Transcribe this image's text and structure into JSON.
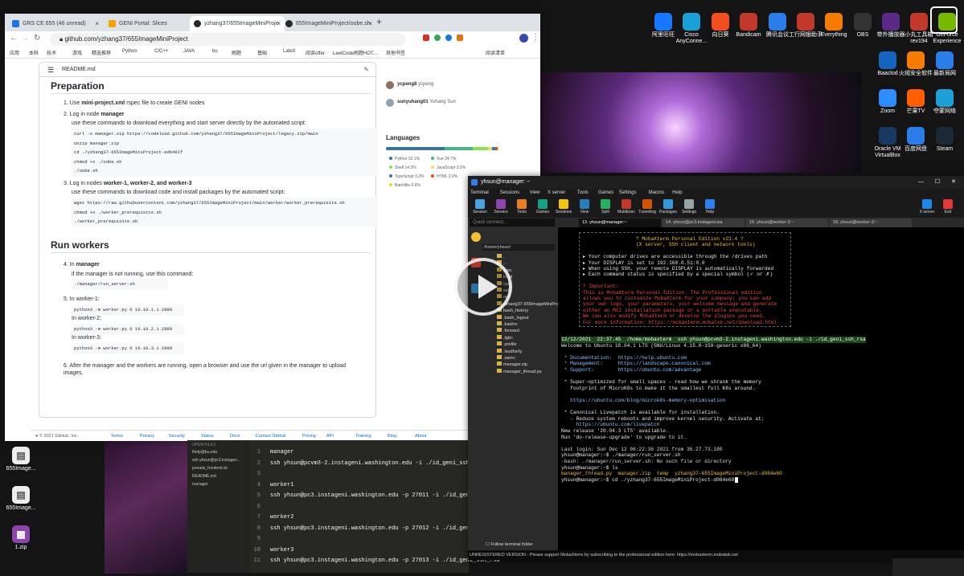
{
  "chrome": {
    "tabs": [
      {
        "title": "GRS CE 655 (46 unread)",
        "color": "#1a73e8"
      },
      {
        "title": "GENI Portal: Slices",
        "color": "#f4a300"
      },
      {
        "title": "yzhang37/655ImageMiniProje",
        "color": "#24292f"
      },
      {
        "title": "655ImageMiniProject/oobe.sh",
        "color": "#24292f"
      }
    ],
    "new_tab": "+",
    "url": "github.com/yzhang37/655ImageMiniProject",
    "bookmarks": [
      "应用",
      "本科",
      "技术",
      "游戏",
      "精选推荐",
      "Python",
      "C/C++",
      "JAVA",
      "bu",
      "刷题",
      "基础",
      "LateX",
      "阅读offer",
      "LeetCode刷题HOT...",
      "其他书签",
      "阅读清单"
    ]
  },
  "readme": {
    "file": "README.md",
    "preparation_heading": "Preparation",
    "step1_prefix": "1. Use ",
    "step1_bold": "mini-project.xml",
    "step1_rest": " rspec file to create GENI nodes",
    "step2_prefix": "2. Log in node ",
    "step2_bold": "manager",
    "step2_line2": "use these commands to download everything and start server directly by the automated script:",
    "code1": "curl -o manager.zip https://codeload.github.com/yzhang37/655ImageMiniProject/legacy.zip/main\nunzip manager.zip\ncd ./yzhang37-655ImageMiniProject-edb461f\nchmod +x ./oobe.sh\n./oobe.sh",
    "step3_prefix": "3. Log in nodes ",
    "step3_bold": "worker-1, worker-2, and worker-3",
    "step3_line2": "use these commands to download code and install packages by the automated script:",
    "code2": "wget https://raw.githubusercontent.com/yzhang37/655ImageMiniProject/main/worker/worker_prerequisite.sh\nchmod +x ./worker_prerequisite.sh\n./worker_prerequisite.sh",
    "run_heading": "Run workers",
    "step4_prefix": "4. In ",
    "step4_bold": "manager",
    "step4_line2": "if the manager is not running, use this command:",
    "code3": "./manager/run_server.sh",
    "step5": "5. In worker-1:",
    "code4": "python3 -m worker.py 0 10.10.1.1 2888",
    "w2": "In worker-2:",
    "code5": "python3 -m worker.py 0 10.10.2.1 2889",
    "w3": "In worker-3:",
    "code6": "python3 -m worker.py 0 10.10.3.1 2890",
    "step6": "6. After the manager and the workers are running, open a browser and use the url given in the manager to upload images."
  },
  "sidebar": {
    "contributors": [
      {
        "user": "ycpeng8",
        "name": "ycpeng"
      },
      {
        "user": "sunyuhang01",
        "name": "Yuhang Sun"
      }
    ],
    "languages_heading": "Languages",
    "languages": [
      {
        "name": "Python",
        "pct": "52.1%",
        "color": "#3572A5"
      },
      {
        "name": "Vue",
        "pct": "24.7%",
        "color": "#41b883"
      },
      {
        "name": "Shell",
        "pct": "14.2%",
        "color": "#89e051"
      },
      {
        "name": "JavaScript",
        "pct": "3.2%",
        "color": "#f1e05a"
      },
      {
        "name": "TypeScript",
        "pct": "3.2%",
        "color": "#3178c6"
      },
      {
        "name": "HTML",
        "pct": "2.0%",
        "color": "#e34c26"
      },
      {
        "name": "Batchfile",
        "pct": "0.6%",
        "color": "#C1F12E"
      }
    ]
  },
  "footer": {
    "copyright": "© 2021 GitHub, Inc.",
    "links": [
      "Terms",
      "Privacy",
      "Security",
      "Status",
      "Docs",
      "Contact GitHub",
      "Pricing",
      "API",
      "Training",
      "Blog",
      "About"
    ]
  },
  "editor": {
    "open_files_heading": "OPEN FILES",
    "files": [
      "thelp@bu.edu",
      "ssh yhsun@pc3.instagen...",
      "presets_frontend.sh",
      "README.md",
      "manager"
    ],
    "lines": [
      {
        "n": "1",
        "t": "manager"
      },
      {
        "n": "2",
        "t": "ssh yhsun@pcvm3-2.instageni.washington.edu -i ./id_geni_ssh_rsa"
      },
      {
        "n": "3",
        "t": ""
      },
      {
        "n": "4",
        "t": "worker1"
      },
      {
        "n": "5",
        "t": "ssh yhsun@pc3.instageni.washington.edu -p 27011 -i ./id_geni_ssh_rsa"
      },
      {
        "n": "6",
        "t": ""
      },
      {
        "n": "7",
        "t": "worker2"
      },
      {
        "n": "8",
        "t": "ssh yhsun@pc3.instageni.washington.edu -p 27012 -i ./id_geni_ssh_rsa"
      },
      {
        "n": "9",
        "t": ""
      },
      {
        "n": "10",
        "t": "worker3"
      },
      {
        "n": "11",
        "t": "ssh yhsun@pc3.instageni.washington.edu -p 27013 -i ./id_geni_ssh_rsa"
      }
    ]
  },
  "moba": {
    "title": "yhsun@manager: ~",
    "menu": [
      "Terminal",
      "Sessions",
      "View",
      "X server",
      "Tools",
      "Games",
      "Settings",
      "Macros",
      "Help"
    ],
    "tools": [
      "Session",
      "Servers",
      "Tools",
      "Games",
      "Sessions",
      "View",
      "Split",
      "MultiExec",
      "Tunneling",
      "Packages",
      "Settings",
      "Help"
    ],
    "right_tools": [
      "X server",
      "Exit"
    ],
    "quick_placeholder": "Quick connect...",
    "tabs": [
      "13. yhsun@manager:~",
      "14. yhsun@pc3.instageni.wa",
      "16. yhsun@worker-2:~",
      "18. yhsun@worker-3:~"
    ],
    "path": "/home/yhsun/",
    "tree": [
      ".",
      "..",
      "grpc",
      "local",
      "cpm",
      "ssh",
      "opt",
      "yzhang37-655ImageMiniProje...",
      "bash_history",
      ".bash_logout",
      ".bashrc",
      ".forward",
      ".lgtrc",
      ".profile",
      ".lsudhsrly",
      ".sanrc",
      "manager.zip",
      "manager_thread.py"
    ],
    "follow": "Follow terminal folder",
    "banner": [
      "? MobaXterm Personal Edition v21.4 ?",
      "(X server, SSH client and network tools)",
      "",
      "▸ Your computer drives are accessible through the /drives path",
      "▸ Your DISPLAY is set to 192.168.0.51:0.0",
      "▸ When using SSH, your remote DISPLAY is automatically forwarded",
      "▸ Each command status is specified by a special symbol (✓ or ✗)",
      "",
      "? Important:",
      "This is MobaXterm Personal Edition. The Professional edition",
      "allows you to customize MobaXterm for your company: you can add",
      "your own logo, your parameters, your welcome message and generate",
      "either an MSI installation package or a portable executable.",
      "We can also modify MobaXterm or develop the plugins you need.",
      "For more information: https://mobaxterm.mobatek.net/download.html"
    ],
    "output": [
      "12/12/2021  22:37.45  /home/mobaxterm  ssh yhsun@pcvm3-2.instageni.washington.edu -i ./id_geni_ssh_rsa",
      "Welcome to Ubuntu 18.04.1 LTS (GNU/Linux 4.15.0-159-generic x86_64)",
      "",
      " * Documentation:  https://help.ubuntu.com",
      " * Management:     https://landscape.canonical.com",
      " * Support:        https://ubuntu.com/advantage",
      "",
      " * Super-optimized for small spaces - read how we shrank the memory",
      "   footprint of MicroK8s to make it the smallest full K8s around.",
      "",
      "   https://ubuntu.com/blog/microk8s-memory-optimisation",
      "",
      " * Canonical Livepatch is available for installation.",
      "   - Reduce system reboots and improve kernel security. Activate at:",
      "     https://ubuntu.com/livepatch",
      "New release '20.04.3 LTS' available.",
      "Run 'do-release-upgrade' to upgrade to it.",
      "",
      "Last login: Sun Dec 12 06:22:36 2021 from 36.27.73.180",
      "yhsun@manager:~$ ./manager/run_server.sh",
      "-bash: ./manager/run_server.sh: No such file or directory",
      "yhsun@manager:~$ ls",
      "manager_thread.py  manager.zip  temp  yzhang37-655ImageMiniProject-d084e60",
      "yhsun@manager:~$ cd ./yzhang37-655ImageMiniProject-d084e60"
    ],
    "status": "UNREGISTERED VERSION  -  Please support MobaXterm by subscribing to the professional edition here:  https://mobaxterm.mobatek.net"
  },
  "desktop": {
    "icons": [
      {
        "label": "阿里旺旺",
        "color": "#1677ff"
      },
      {
        "label": "Cisco AnyConne...",
        "color": "#1ba0d7"
      },
      {
        "label": "向日葵",
        "color": "#f24e1e"
      },
      {
        "label": "Bandicam",
        "color": "#c0392b"
      },
      {
        "label": "腾讯会议",
        "color": "#2b7de9"
      },
      {
        "label": "工行网银助手",
        "color": "#c0392b"
      },
      {
        "label": "Everything",
        "color": "#f57c00"
      },
      {
        "label": "OBS",
        "color": "#333"
      },
      {
        "label": "带外播放器",
        "color": "#5b2a86"
      },
      {
        "label": "小丸工具箱 rev194",
        "color": "#c0392b"
      },
      {
        "label": "GeForce Experience",
        "color": "#76b900"
      },
      {
        "label": "Baaclod",
        "color": "#1565c0"
      },
      {
        "label": "火绒安全软件",
        "color": "#f57c00"
      },
      {
        "label": "最新局网",
        "color": "#2b7de9"
      },
      {
        "label": "Zoom",
        "color": "#2d8cff"
      },
      {
        "label": "芒果TV",
        "color": "#ff5f00"
      },
      {
        "label": "夺蒙网络",
        "color": "#1ba0d7"
      },
      {
        "label": "Oracle VM VirtualBox",
        "color": "#183a61"
      },
      {
        "label": "百度网盘",
        "color": "#2b7de9"
      },
      {
        "label": "Steam",
        "color": "#1b2838"
      }
    ],
    "left_icons": [
      "655Image...",
      "655Image...",
      "1.zip"
    ]
  }
}
